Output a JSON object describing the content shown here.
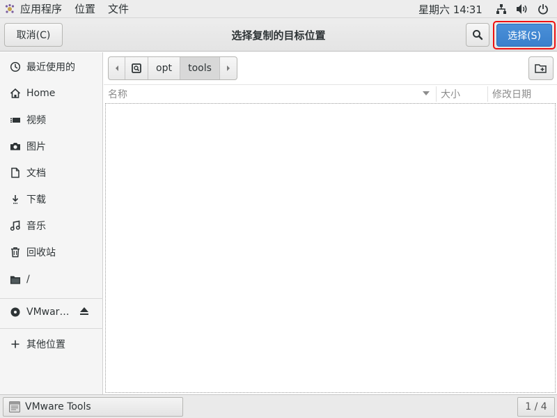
{
  "top_panel": {
    "apps_menu": "应用程序",
    "places_menu": "位置",
    "file_menu": "文件",
    "clock": "星期六 14∶31",
    "status_icons": [
      "network-icon",
      "volume-icon",
      "power-icon"
    ]
  },
  "dialog": {
    "title": "选择复制的目标位置",
    "cancel_label": "取消(C)",
    "select_label": "选择(S)",
    "search_icon": "search-icon"
  },
  "sidebar": {
    "items": [
      {
        "label": "最近使用的",
        "icon": "recent-icon"
      },
      {
        "label": "Home",
        "icon": "home-icon"
      },
      {
        "label": "视频",
        "icon": "video-icon"
      },
      {
        "label": "图片",
        "icon": "camera-icon"
      },
      {
        "label": "文档",
        "icon": "document-icon"
      },
      {
        "label": "下载",
        "icon": "download-icon"
      },
      {
        "label": "音乐",
        "icon": "music-icon"
      },
      {
        "label": "回收站",
        "icon": "trash-icon"
      },
      {
        "label": "/",
        "icon": "folder-icon"
      }
    ],
    "device": {
      "label": "VMwar…",
      "icon": "disc-icon",
      "eject_icon": "eject-icon"
    },
    "other_locations": {
      "label": "其他位置",
      "icon": "plus-icon"
    }
  },
  "pathbar": {
    "segments": [
      "opt",
      "tools"
    ],
    "active_segment": "tools",
    "root_icon": "drive-icon"
  },
  "columns": {
    "name": "名称",
    "size": "大小",
    "modified": "修改日期",
    "sort": "descending"
  },
  "taskbar": {
    "window_title": "VMware Tools",
    "workspace_pager": "1 / 4"
  },
  "colors": {
    "accent": "#3b84d0",
    "highlight_border": "#ee1111"
  }
}
